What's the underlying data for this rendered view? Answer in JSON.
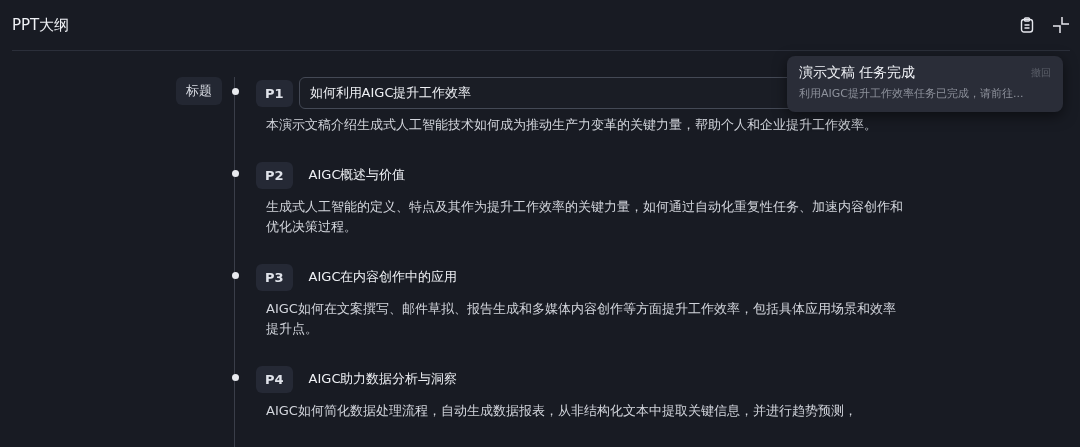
{
  "header": {
    "title": "PPT大纲"
  },
  "outline": {
    "section_label": "标题",
    "slides": [
      {
        "page": "P1",
        "title": "如何利用AIGC提升工作效率",
        "editing": true,
        "description": "本演示文稿介绍生成式人工智能技术如何成为推动生产力变革的关键力量，帮助个人和企业提升工作效率。"
      },
      {
        "page": "P2",
        "title": "AIGC概述与价值",
        "editing": false,
        "description": "生成式人工智能的定义、特点及其作为提升工作效率的关键力量，如何通过自动化重复性任务、加速内容创作和优化决策过程。"
      },
      {
        "page": "P3",
        "title": "AIGC在内容创作中的应用",
        "editing": false,
        "description": "AIGC如何在文案撰写、邮件草拟、报告生成和多媒体内容创作等方面提升工作效率，包括具体应用场景和效率提升点。"
      },
      {
        "page": "P4",
        "title": "AIGC助力数据分析与洞察",
        "editing": false,
        "description": "AIGC如何简化数据处理流程，自动生成数据报表，从非结构化文本中提取关键信息，并进行趋势预测，"
      }
    ]
  },
  "toast": {
    "title": "演示文稿 任务完成",
    "message": "利用AIGC提升工作效率任务已完成，请前往...",
    "action": "撤回"
  }
}
